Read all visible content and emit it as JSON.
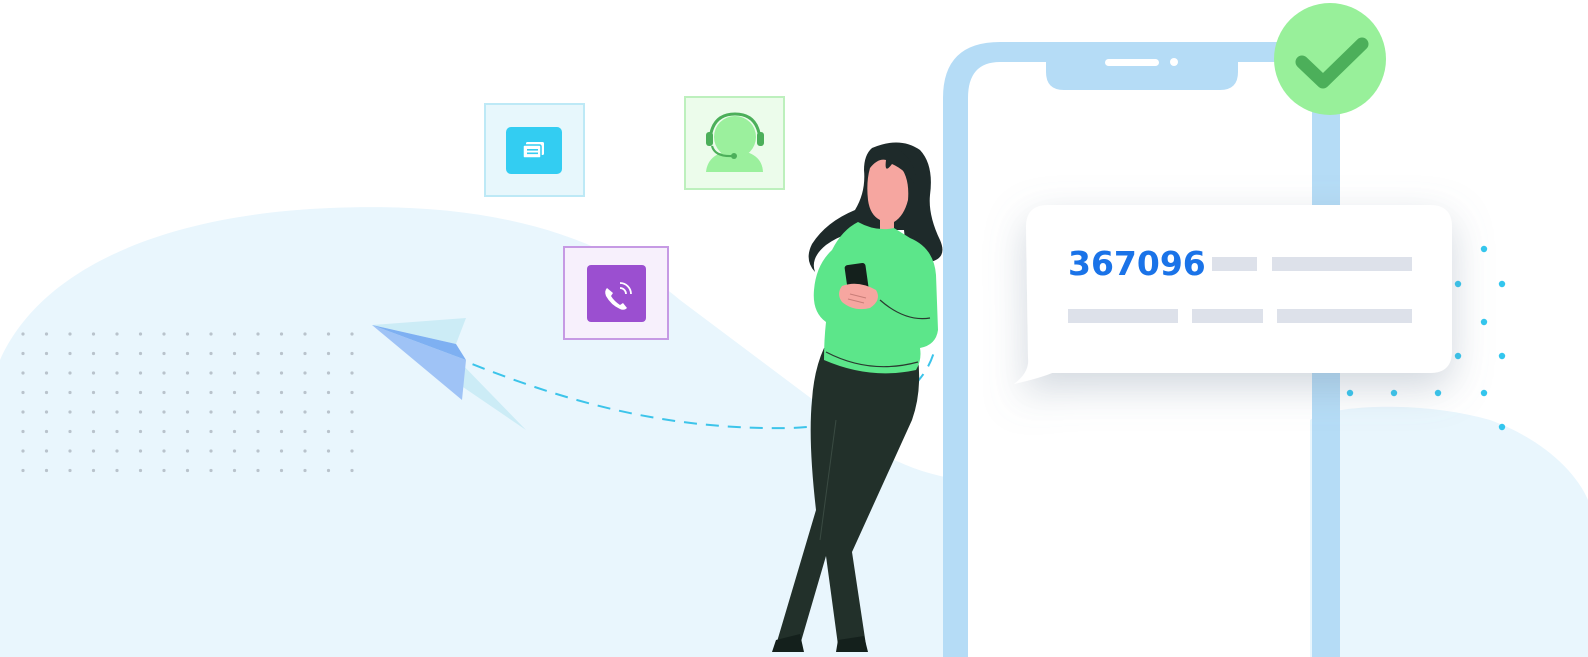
{
  "otp_bubble": {
    "code": "367096"
  },
  "icons": {
    "message": "chat-bubble-icon",
    "support": "headset-support-icon",
    "call": "phone-call-icon",
    "verified": "checkmark-icon",
    "sent": "paper-plane-icon"
  },
  "colors": {
    "background_blob": "#e9f6fd",
    "phone_frame": "#b5dcf6",
    "code_text": "#1a73e8",
    "check_badge": "#98f09a",
    "check_mark": "#4caf5a",
    "message_tile": "#33cdf2",
    "support_tile": "#9bf09d",
    "call_tile": "#9b4fd0",
    "sweater": "#5ce68a",
    "pants": "#22302a",
    "hair": "#1e2a2a",
    "skin": "#f6a6a0",
    "dashed_path": "#3cc4ea",
    "placeholder_bar": "#dde1ea"
  }
}
